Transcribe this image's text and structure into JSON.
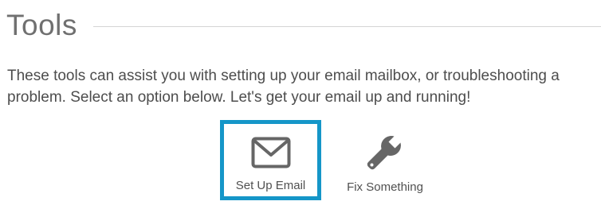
{
  "header": {
    "title": "Tools"
  },
  "intro": {
    "text": "These tools can assist you with setting up your email mailbox, or troubleshooting a problem. Select an option below. Let's get your email up and running!"
  },
  "tools": [
    {
      "label": "Set Up Email",
      "icon": "envelope-icon",
      "selected": true
    },
    {
      "label": "Fix Something",
      "icon": "wrench-icon",
      "selected": false
    }
  ],
  "colors": {
    "selection_border": "#1596c8",
    "icon": "#666666",
    "text": "#4d4d4d"
  }
}
